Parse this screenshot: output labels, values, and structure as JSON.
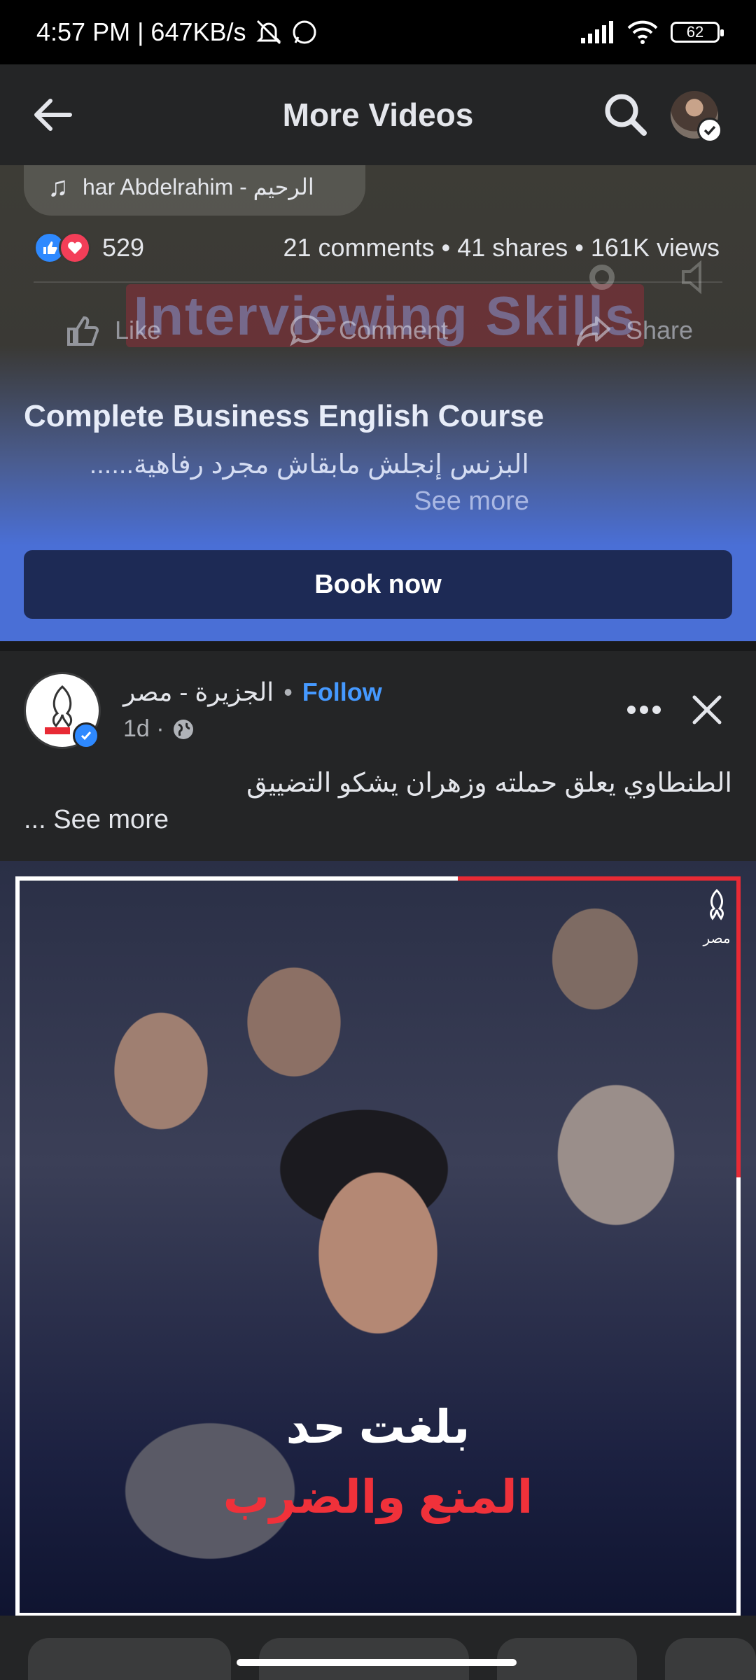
{
  "status_bar": {
    "time_speed": "4:57 PM | 647KB/s",
    "battery": "62"
  },
  "header": {
    "title": "More Videos",
    "icons": [
      "back-arrow-icon",
      "search-icon",
      "profile-avatar"
    ]
  },
  "sponsored_video": {
    "music": "har Abdelrahim - الرحيم",
    "reaction_count": "529",
    "counts": "21 comments • 41 shares • 161K views",
    "watermark": "Interviewing Skills",
    "actions": {
      "like": "Like",
      "comment": "Comment",
      "share": "Share"
    },
    "ad_title": "Complete Business English Course",
    "ad_description": "البزنس إنجلش مابقاش مجرد رفاهية......",
    "see_more": "See more",
    "cta": "Book now"
  },
  "post": {
    "page_name": "الجزيرة - مصر",
    "separator": "•",
    "follow": "Follow",
    "time": "1d ·",
    "text": "الطنطاوي يعلق حملته وزهران يشكو التضييق",
    "see_more": "... See more",
    "image_caption_line1": "بلغت حد",
    "image_caption_line2": "المنع والضرب",
    "logo_text": "مصر"
  },
  "colors": {
    "background": "#242526",
    "ad_blue": "#4a6fd6",
    "cta_navy": "#1d2a55",
    "follow_blue": "#4599ff",
    "accent_red": "#e82a35"
  }
}
